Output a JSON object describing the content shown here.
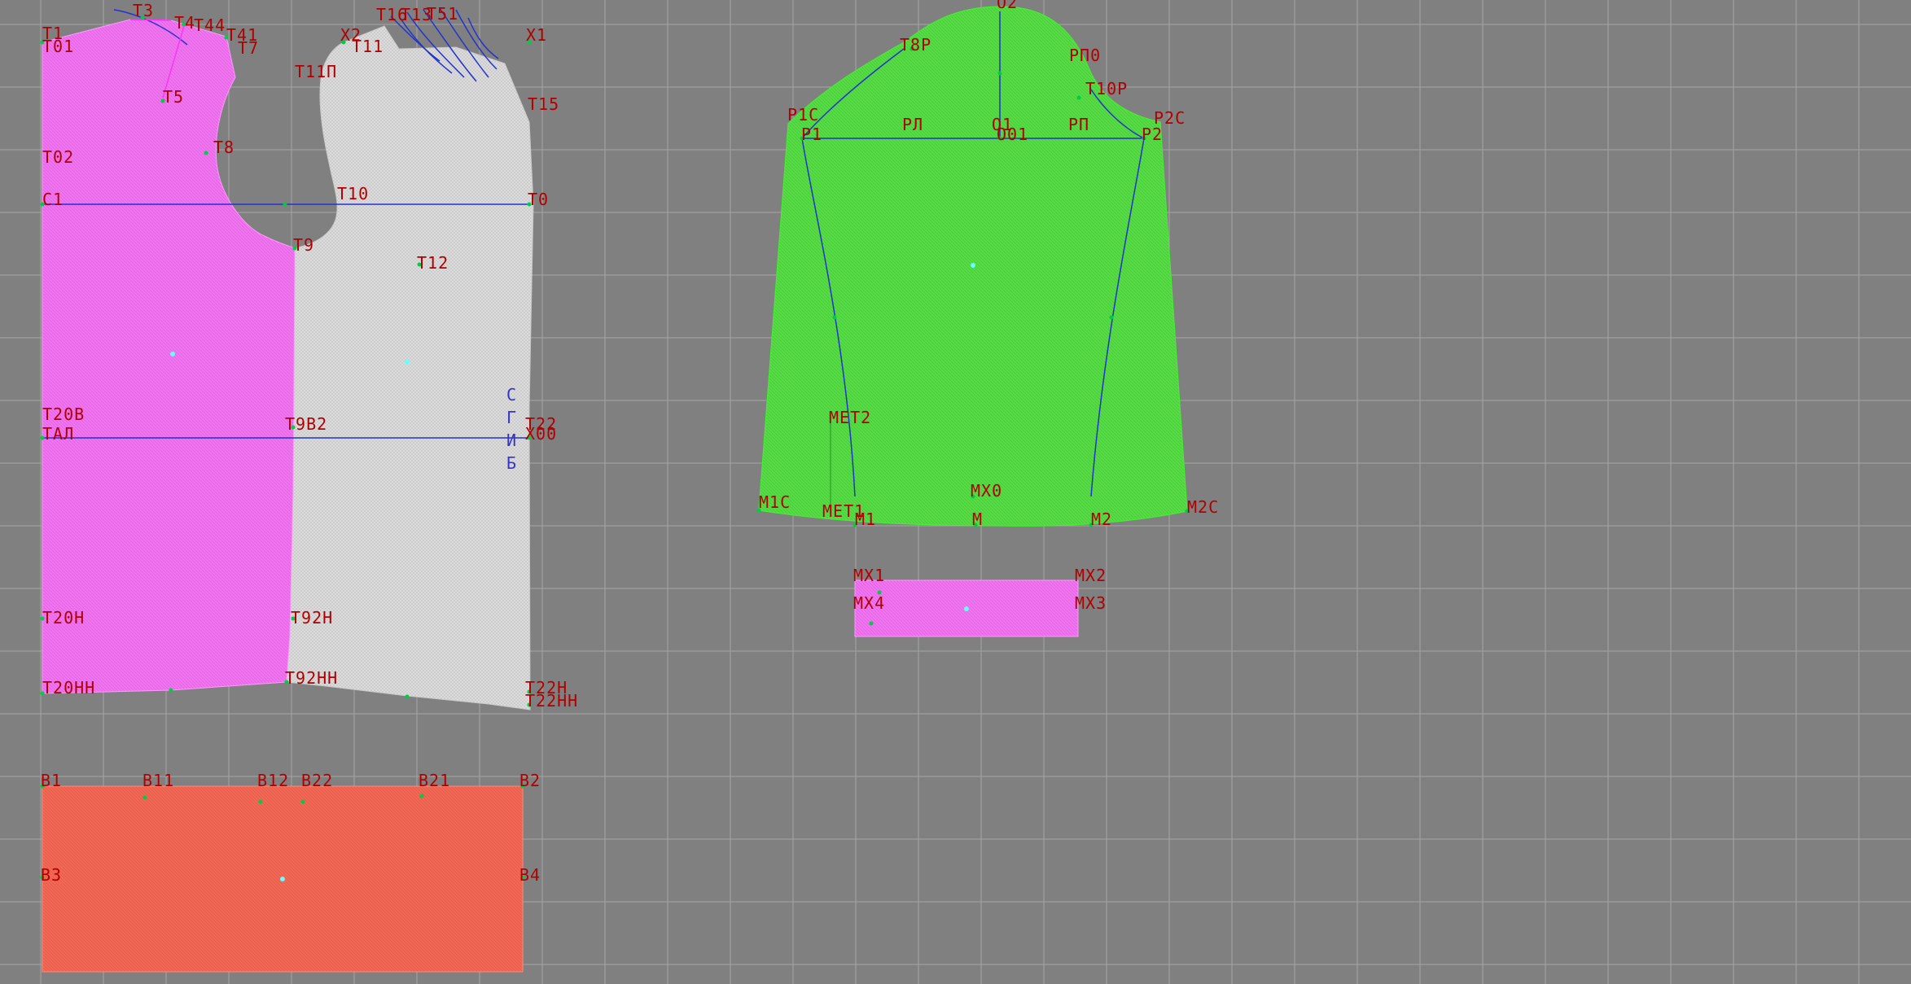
{
  "colors": {
    "background": "#808080",
    "grid": "#a6a6a6",
    "front_fill": "#ee77ee",
    "back_fill": "#d9d9d9",
    "sleeve_fill": "#55dd44",
    "cuff_fill": "#ee77ee",
    "band_fill": "#f06a55",
    "label": "#b00000",
    "construction_line": "#2233cc",
    "point": "#00cc44",
    "center_point": "#66ffff"
  },
  "labels": {
    "T1": "T1",
    "T01": "T01",
    "T3": "T3",
    "T4": "T4",
    "T44": "T44",
    "T41": "T41",
    "T7": "T7",
    "T5": "T5",
    "T02": "T02",
    "T8": "T8",
    "C1": "C1",
    "T10": "T10",
    "T0": "T0",
    "T9": "T9",
    "X2": "X2",
    "T11": "T11",
    "T11P": "T11П",
    "X1": "X1",
    "T12": "T12",
    "T16": "T16",
    "T13": "T13",
    "T51": "T51",
    "T15": "T15",
    "T20V": "T20B",
    "TAL": "TAЛ",
    "T9B2": "T9B2",
    "T22": "T22",
    "X00": "X00",
    "T20N": "T20H",
    "T92N": "T92H",
    "T20NN": "T20HH",
    "T92NN": "T92HH",
    "T22N": "T22H",
    "T22NN": "T22HH",
    "O2": "O2",
    "T8P": "T8P",
    "RP0": "PП0",
    "T10P": "T10P",
    "R1C": "P1C",
    "R1": "P1",
    "RL": "PЛ",
    "O1": "O1",
    "O01": "O01",
    "RP": "PП",
    "R2": "P2",
    "R2C": "P2C",
    "MET2": "MET2",
    "MX0": "MX0",
    "M1C": "M1C",
    "MET1": "MET1",
    "M1": "M1",
    "M": "M",
    "M2": "M2",
    "M2C": "M2C",
    "MX1": "MX1",
    "MX2": "MX2",
    "MX3": "MX3",
    "MX4": "MX4",
    "B1": "B1",
    "B11": "B11",
    "B12": "B12",
    "B22": "B22",
    "B21": "B21",
    "B2": "B2",
    "B3": "B3",
    "B4": "B4"
  },
  "fold_text": "СГИБ"
}
